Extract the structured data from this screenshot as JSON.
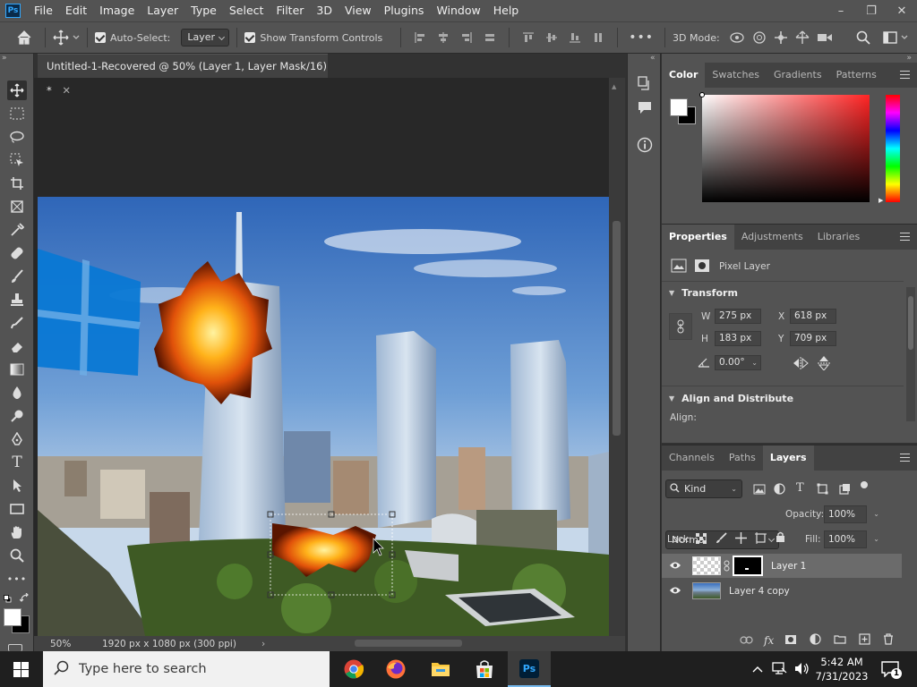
{
  "app": {
    "logo": "Ps"
  },
  "menu": [
    "File",
    "Edit",
    "Image",
    "Layer",
    "Type",
    "Select",
    "Filter",
    "3D",
    "View",
    "Plugins",
    "Window",
    "Help"
  ],
  "window_controls": {
    "minimize": "–",
    "restore": "❐",
    "close": "✕"
  },
  "options_bar": {
    "auto_select_label": "Auto-Select:",
    "auto_select_value": "Layer",
    "show_transform_label": "Show Transform Controls",
    "mode_3d_label": "3D Mode:",
    "more": "•••"
  },
  "document": {
    "tab_title": "Untitled-1-Recovered @ 50% (Layer 1, Layer Mask/16) *",
    "zoom": "50%",
    "doc_info": "1920 px x 1080 px (300 ppi)"
  },
  "color_panel": {
    "tabs": [
      "Color",
      "Swatches",
      "Gradients",
      "Patterns"
    ],
    "active": "Color"
  },
  "properties_panel": {
    "tabs": [
      "Properties",
      "Adjustments",
      "Libraries"
    ],
    "active": "Properties",
    "layer_type": "Pixel Layer",
    "transform_title": "Transform",
    "w_label": "W",
    "w_value": "275 px",
    "h_label": "H",
    "h_value": "183 px",
    "x_label": "X",
    "x_value": "618 px",
    "y_label": "Y",
    "y_value": "709 px",
    "angle_value": "0.00°",
    "align_title": "Align and Distribute",
    "align_label": "Align:"
  },
  "layers_panel": {
    "tabs": [
      "Channels",
      "Paths",
      "Layers"
    ],
    "active": "Layers",
    "filter_kind": "Kind",
    "blend_mode": "Normal",
    "opacity_label": "Opacity:",
    "opacity_value": "100%",
    "lock_label": "Lock:",
    "fill_label": "Fill:",
    "fill_value": "100%",
    "layers": [
      {
        "name": "Layer 1",
        "selected": true,
        "visible": true
      },
      {
        "name": "Layer 4 copy",
        "selected": false,
        "visible": true
      }
    ]
  },
  "taskbar": {
    "search_placeholder": "Type here to search",
    "time": "5:42 AM",
    "date": "7/31/2023",
    "notification_count": "1"
  },
  "colors": {
    "accent": "#31a8ff",
    "ui_bg": "#535353",
    "dark_bg": "#282828"
  }
}
